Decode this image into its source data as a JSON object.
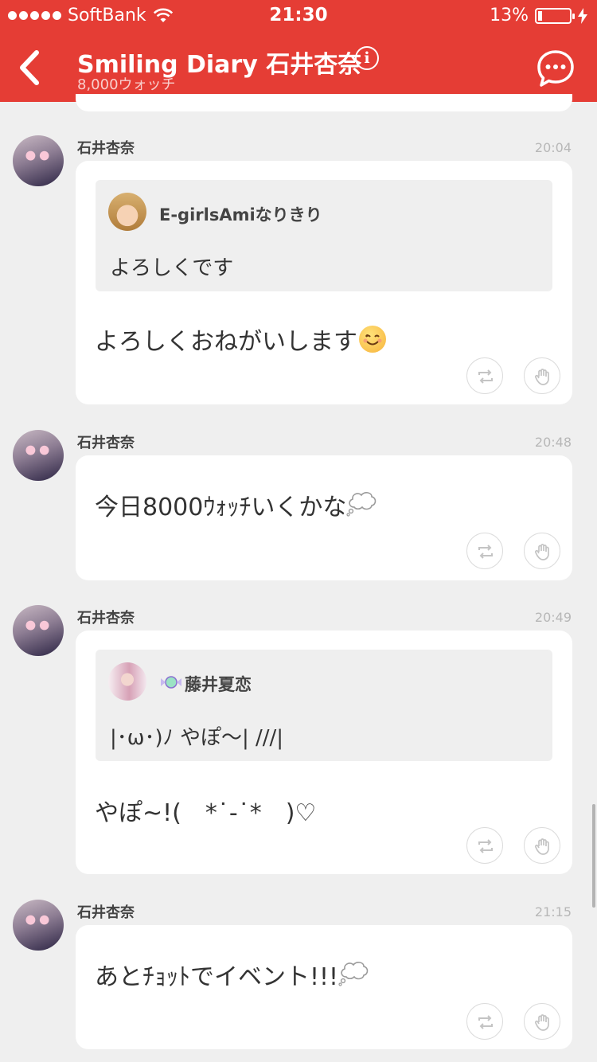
{
  "status_bar": {
    "carrier": "SoftBank",
    "time": "21:30",
    "battery_percent": "13%",
    "battery_level": 0.13
  },
  "header": {
    "title": "Smiling Diary 石井杏奈",
    "subtitle": "8,000ウォッチ"
  },
  "colors": {
    "header_bg": "#e53d35",
    "page_bg": "#efefef",
    "card_bg": "#ffffff"
  },
  "posts": [
    {
      "author": "石井杏奈",
      "time": "20:04",
      "quote": {
        "name": "E-girlsAmiなりきり",
        "text": "よろしくです"
      },
      "text": "よろしくおねがいします",
      "trailing_icon": "smiling-face-emoji"
    },
    {
      "author": "石井杏奈",
      "time": "20:48",
      "text": "今日8000ｳｫｯﾁいくかな",
      "trailing_icon": "thought-bubble-emoji"
    },
    {
      "author": "石井杏奈",
      "time": "20:49",
      "quote": {
        "name": "藤井夏恋",
        "text": "|･ω･)ﾉ やぽ〜| ///|"
      },
      "text": "やぽ~!(　*˙-˙*　)♡"
    },
    {
      "author": "石井杏奈",
      "time": "21:15",
      "text": "あとﾁｮｯﾄでイベント!!!",
      "trailing_icon": "thought-bubble-emoji"
    }
  ],
  "icons": {
    "back": "chevron-left-icon",
    "info": "info-icon",
    "chat": "chat-bubble-icon",
    "repost": "repost-icon",
    "clap": "hand-icon"
  }
}
